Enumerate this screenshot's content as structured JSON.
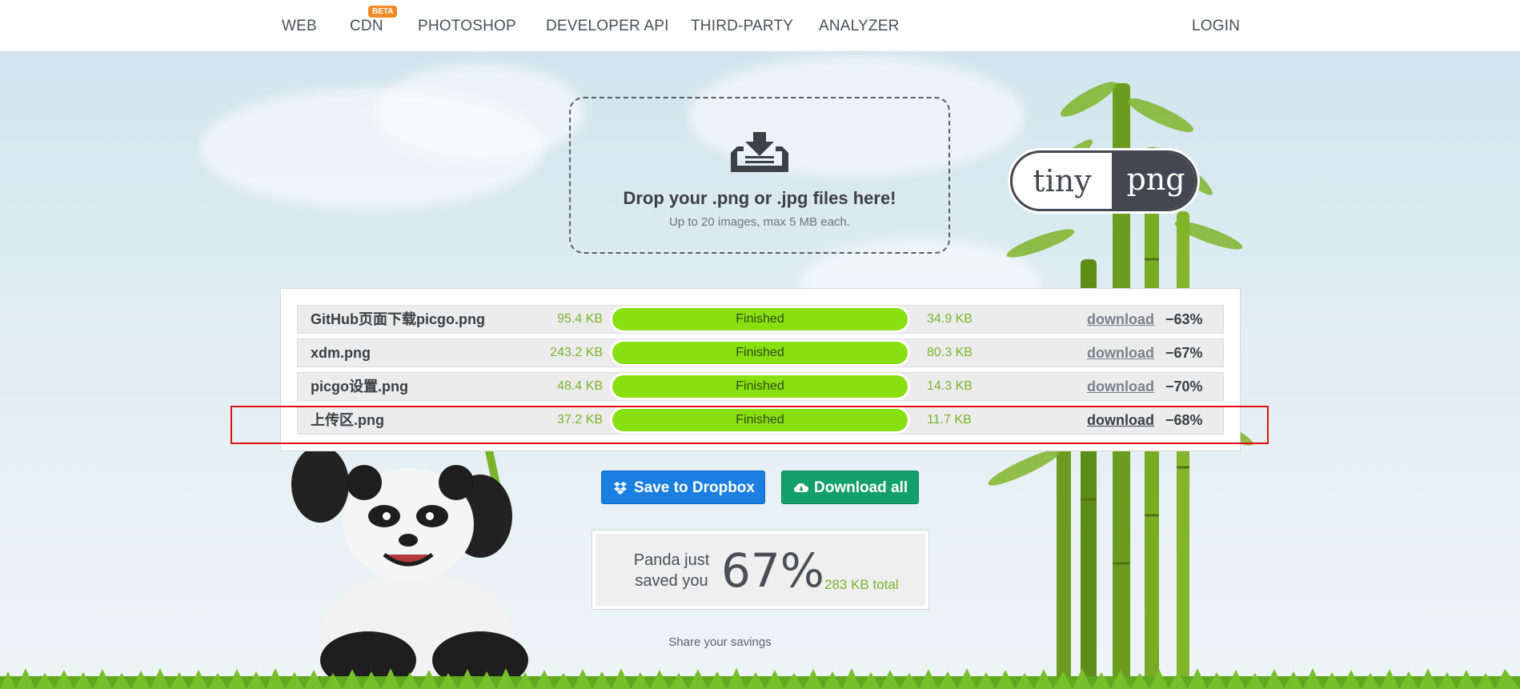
{
  "nav": {
    "items": [
      "WEB",
      "CDN",
      "PHOTOSHOP",
      "DEVELOPER API",
      "THIRD-PARTY",
      "ANALYZER"
    ],
    "cdn_badge": "BETA",
    "login": "LOGIN"
  },
  "dropzone": {
    "title": "Drop your .png or .jpg files here!",
    "subtitle": "Up to 20 images, max 5 MB each."
  },
  "logo": {
    "left": "tiny",
    "right": "png"
  },
  "files": [
    {
      "name": "GitHub页面下载picgo.png",
      "original_size": "95.4 KB",
      "status": "Finished",
      "new_size": "34.9 KB",
      "action": "download",
      "saving": "−63%"
    },
    {
      "name": "xdm.png",
      "original_size": "243.2 KB",
      "status": "Finished",
      "new_size": "80.3 KB",
      "action": "download",
      "saving": "−67%"
    },
    {
      "name": "picgo设置.png",
      "original_size": "48.4 KB",
      "status": "Finished",
      "new_size": "14.3 KB",
      "action": "download",
      "saving": "−70%"
    },
    {
      "name": "上传区.png",
      "original_size": "37.2 KB",
      "status": "Finished",
      "new_size": "11.7 KB",
      "action": "download",
      "saving": "−68%"
    }
  ],
  "buttons": {
    "dropbox": "Save to Dropbox",
    "download_all": "Download all"
  },
  "savings": {
    "line1": "Panda just",
    "line2": "saved you",
    "percent": "67%",
    "total": "283 KB total"
  },
  "share": "Share your savings",
  "colors": {
    "accent_green": "#88e011",
    "size_text": "#7bb32a",
    "dropbox_blue": "#1a7fe0",
    "download_green": "#14a06a",
    "highlight_red": "#e01010"
  }
}
